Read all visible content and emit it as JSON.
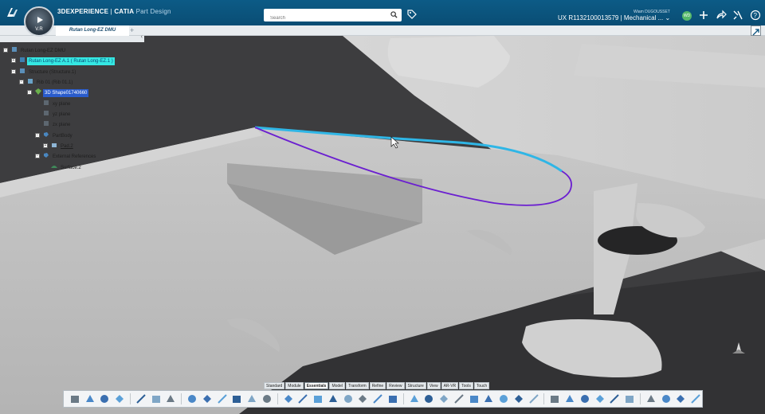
{
  "header": {
    "brand": "3DEXPERIENCE",
    "separator": " | ",
    "product": "CATIA",
    "app": "Part Design",
    "compass_version": "V.R",
    "search_placeholder": "Search",
    "user_name": "Wiam DUGOUSSET",
    "context": "UX R1132100013579 | Mechanical ...",
    "avatar_initials": "WD"
  },
  "tabs": [
    {
      "label": "Rutan Long-EZ DMU"
    }
  ],
  "tab_add": "+",
  "tree": {
    "nodes": [
      {
        "label": "Rutan Long-EZ DMU",
        "style": ""
      },
      {
        "label": "Rutan Long-EZ A.1 ( Rutan Long-EZ.1 )",
        "style": "cyan"
      },
      {
        "label": "Structure (Structure.1)",
        "style": ""
      },
      {
        "label": "Rib 01 (Rib 01.1)",
        "style": ""
      },
      {
        "label": "3D Shape01740660",
        "style": "blue"
      },
      {
        "label": "xy plane",
        "style": ""
      },
      {
        "label": "yz plane",
        "style": ""
      },
      {
        "label": "zx plane",
        "style": ""
      },
      {
        "label": "PartBody",
        "style": ""
      },
      {
        "label": "Pad.2",
        "style": "ul"
      },
      {
        "label": "External References",
        "style": ""
      },
      {
        "label": "Surface.2",
        "style": ""
      }
    ]
  },
  "action_tabs": [
    "Standard",
    "Module",
    "Essentials",
    "Model",
    "Transform",
    "Refine",
    "Review",
    "Structure",
    "View",
    "AR-VR",
    "Tools",
    "Touch"
  ],
  "active_action_tab": "Essentials",
  "colors": {
    "topbar": "#0b5480",
    "highlight_cyan": "#35e8e3",
    "selection_blue": "#2a5ccc",
    "curve_blue": "#2fb6e6",
    "curve_purple": "#6b1fd0"
  },
  "toolbar_icons": [
    "cut-icon",
    "copy-icon",
    "paste-icon",
    "undo-icon",
    "fit-all-icon",
    "select-icon",
    "sketch-icon",
    "part-icon",
    "point-icon",
    "line-icon",
    "plane-icon",
    "axis-icon",
    "pad-icon",
    "pocket-icon",
    "shaft-icon",
    "hole-icon",
    "rib-icon",
    "slot-icon",
    "loft-icon",
    "fillet-icon",
    "chamfer-icon",
    "draft-icon",
    "shell-icon",
    "thickness-icon",
    "split-icon",
    "thick-surface-icon",
    "close-surface-icon",
    "pattern-icon",
    "mirror-icon",
    "scale-icon",
    "boolean-icon",
    "measure-icon",
    "render-icon",
    "section-icon",
    "annotation-icon",
    "publish-icon",
    "tools-icon",
    "touch-icon",
    "settings-icon",
    "extra-icon"
  ]
}
